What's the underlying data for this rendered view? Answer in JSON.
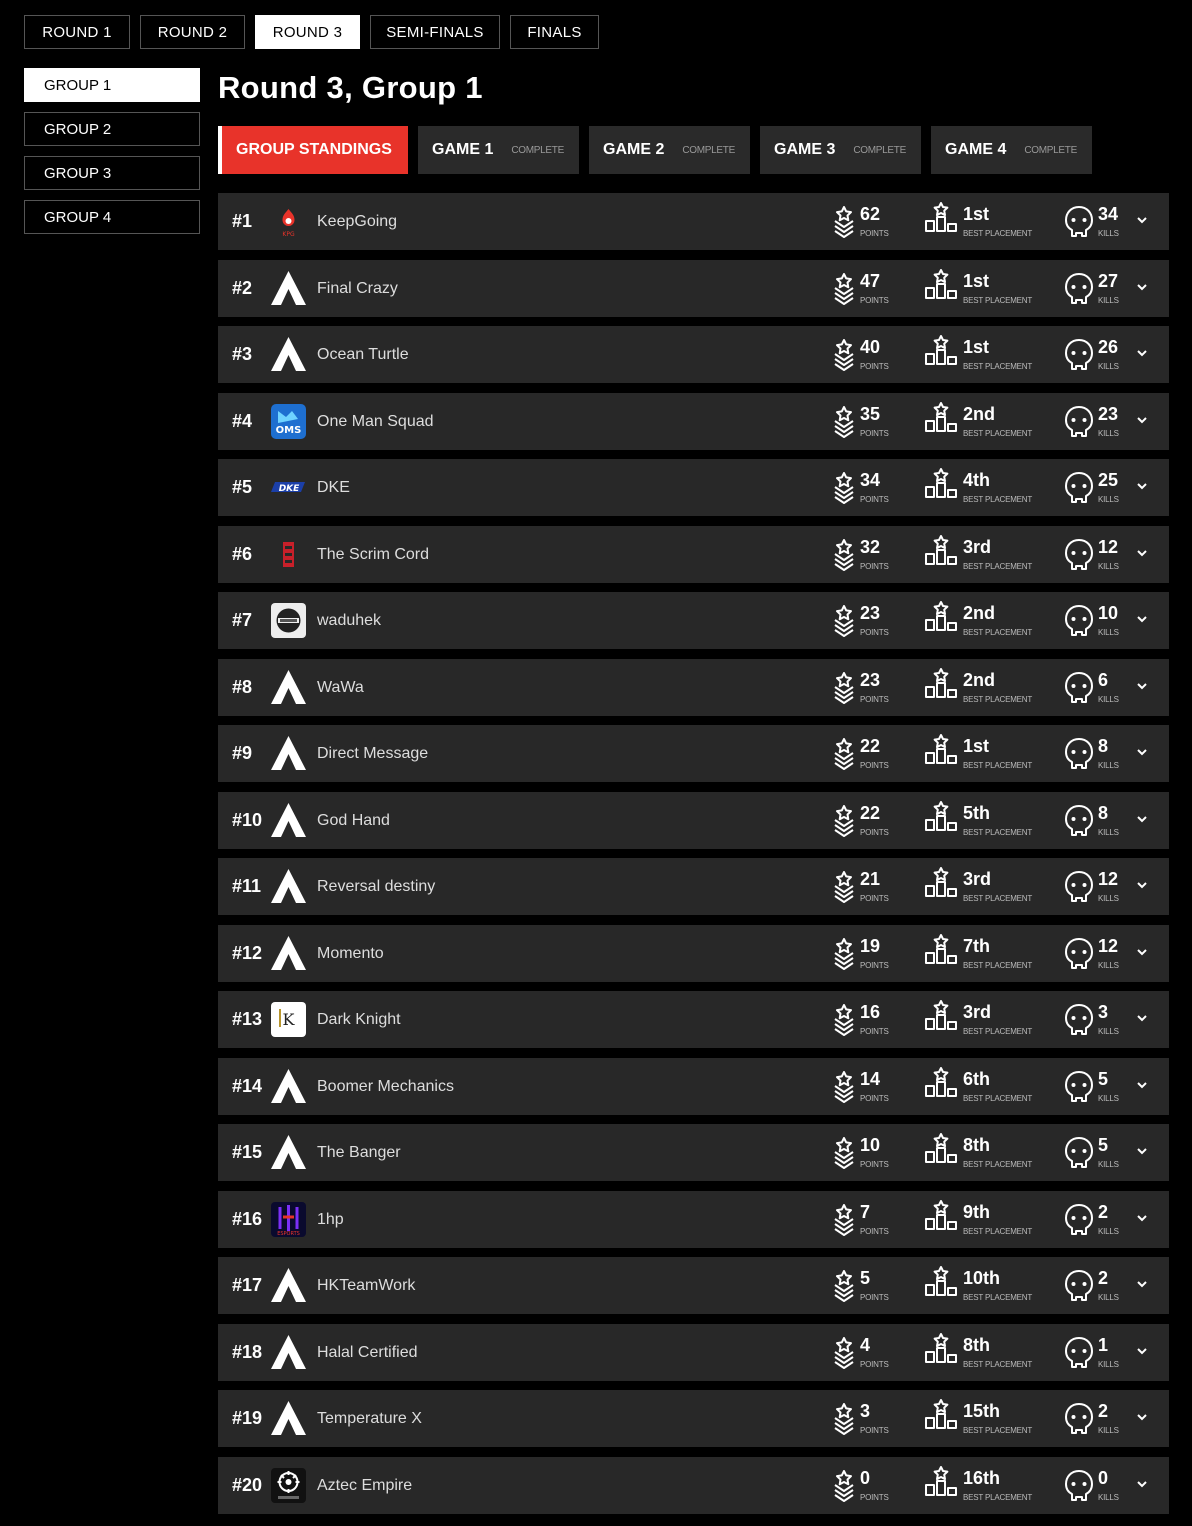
{
  "rounds": [
    {
      "label": "ROUND 1",
      "active": false
    },
    {
      "label": "ROUND 2",
      "active": false
    },
    {
      "label": "ROUND 3",
      "active": true
    },
    {
      "label": "SEMI-FINALS",
      "active": false
    },
    {
      "label": "FINALS",
      "active": false
    }
  ],
  "groups": [
    {
      "label": "GROUP 1",
      "active": true
    },
    {
      "label": "GROUP 2",
      "active": false
    },
    {
      "label": "GROUP 3",
      "active": false
    },
    {
      "label": "GROUP 4",
      "active": false
    }
  ],
  "title": "Round 3, Group 1",
  "tabs": {
    "standings": "GROUP STANDINGS",
    "games": [
      {
        "label": "GAME 1",
        "status": "COMPLETE"
      },
      {
        "label": "GAME 2",
        "status": "COMPLETE"
      },
      {
        "label": "GAME 3",
        "status": "COMPLETE"
      },
      {
        "label": "GAME 4",
        "status": "COMPLETE"
      }
    ]
  },
  "labels": {
    "points": "POINTS",
    "best": "BEST PLACEMENT",
    "kills": "KILLS"
  },
  "colors": {
    "accent": "#e8332a",
    "row_bg": "#282828",
    "background": "#000000"
  },
  "standings": [
    {
      "rank": "#1",
      "team": "KeepGoing",
      "logo": "kpg-logo",
      "points": "62",
      "best": "1st",
      "kills": "34"
    },
    {
      "rank": "#2",
      "team": "Final Crazy",
      "logo": "apex-logo",
      "points": "47",
      "best": "1st",
      "kills": "27"
    },
    {
      "rank": "#3",
      "team": "Ocean Turtle",
      "logo": "apex-logo",
      "points": "40",
      "best": "1st",
      "kills": "26"
    },
    {
      "rank": "#4",
      "team": "One Man Squad",
      "logo": "oms-logo",
      "points": "35",
      "best": "2nd",
      "kills": "23"
    },
    {
      "rank": "#5",
      "team": "DKE",
      "logo": "dke-logo",
      "points": "34",
      "best": "4th",
      "kills": "25"
    },
    {
      "rank": "#6",
      "team": "The Scrim Cord",
      "logo": "scrimcord-logo",
      "points": "32",
      "best": "3rd",
      "kills": "12"
    },
    {
      "rank": "#7",
      "team": "waduhek",
      "logo": "waduhek-logo",
      "points": "23",
      "best": "2nd",
      "kills": "10"
    },
    {
      "rank": "#8",
      "team": "WaWa",
      "logo": "apex-logo",
      "points": "23",
      "best": "2nd",
      "kills": "6"
    },
    {
      "rank": "#9",
      "team": "Direct Message",
      "logo": "apex-logo",
      "points": "22",
      "best": "1st",
      "kills": "8"
    },
    {
      "rank": "#10",
      "team": "God Hand",
      "logo": "apex-logo",
      "points": "22",
      "best": "5th",
      "kills": "8"
    },
    {
      "rank": "#11",
      "team": "Reversal destiny",
      "logo": "apex-logo",
      "points": "21",
      "best": "3rd",
      "kills": "12"
    },
    {
      "rank": "#12",
      "team": "Momento",
      "logo": "apex-logo",
      "points": "19",
      "best": "7th",
      "kills": "12"
    },
    {
      "rank": "#13",
      "team": "Dark Knight",
      "logo": "darkknight-logo",
      "points": "16",
      "best": "3rd",
      "kills": "3"
    },
    {
      "rank": "#14",
      "team": "Boomer Mechanics",
      "logo": "apex-logo",
      "points": "14",
      "best": "6th",
      "kills": "5"
    },
    {
      "rank": "#15",
      "team": "The Banger",
      "logo": "apex-logo",
      "points": "10",
      "best": "8th",
      "kills": "5"
    },
    {
      "rank": "#16",
      "team": "1hp",
      "logo": "1hp-logo",
      "points": "7",
      "best": "9th",
      "kills": "2"
    },
    {
      "rank": "#17",
      "team": "HKTeamWork",
      "logo": "apex-logo",
      "points": "5",
      "best": "10th",
      "kills": "2"
    },
    {
      "rank": "#18",
      "team": "Halal Certified",
      "logo": "apex-logo",
      "points": "4",
      "best": "8th",
      "kills": "1"
    },
    {
      "rank": "#19",
      "team": "Temperature X",
      "logo": "apex-logo",
      "points": "3",
      "best": "15th",
      "kills": "2"
    },
    {
      "rank": "#20",
      "team": "Aztec Empire",
      "logo": "aztec-logo",
      "points": "0",
      "best": "16th",
      "kills": "0"
    }
  ]
}
